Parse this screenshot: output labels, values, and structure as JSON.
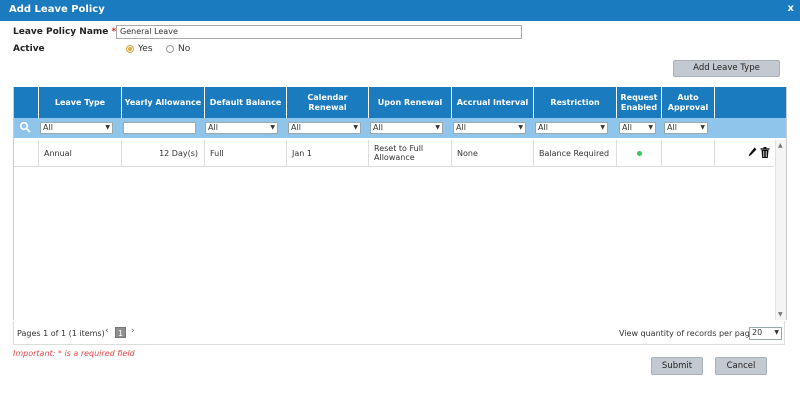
{
  "dialog": {
    "title": "Add Leave Policy",
    "close": "x"
  },
  "form": {
    "policy_name_label": "Leave Policy Name",
    "required_mark": "*",
    "policy_name_value": "General Leave",
    "active_label": "Active",
    "active_options": [
      {
        "label": "Yes",
        "selected": true
      },
      {
        "label": "No",
        "selected": false
      }
    ]
  },
  "add_leave_type_label": "Add Leave Type",
  "grid": {
    "columns": [
      "Leave Type",
      "Yearly Allowance",
      "Default Balance",
      "Calendar Renewal",
      "Upon Renewal",
      "Accrual Interval",
      "Restriction",
      "Request Enabled",
      "Auto Approval"
    ],
    "filters": [
      "All",
      "",
      "All",
      "All",
      "All",
      "All",
      "All",
      "All",
      "All"
    ],
    "rows": [
      {
        "leave_type": "Annual",
        "yearly_allowance": "12  Day(s)",
        "default_balance": "Full",
        "calendar_renewal": "Jan 1",
        "upon_renewal": "Reset to Full Allowance",
        "accrual_interval": "None",
        "restriction": "Balance Required",
        "request_enabled": true,
        "auto_approval": ""
      }
    ]
  },
  "pager": {
    "info": "Pages 1 of 1 (1 items)",
    "prev": "‹",
    "current_page": "1",
    "next": "›",
    "records_label": "View quantity of records per page",
    "records_value": "20"
  },
  "important_note": "Important: * is a required field",
  "buttons": {
    "submit": "Submit",
    "cancel": "Cancel"
  },
  "colors": {
    "header_blue": "#1b7bbf",
    "filter_blue": "#8fc5ea",
    "enabled_dot": "#3cc45a",
    "important_red": "#e44a4a"
  }
}
